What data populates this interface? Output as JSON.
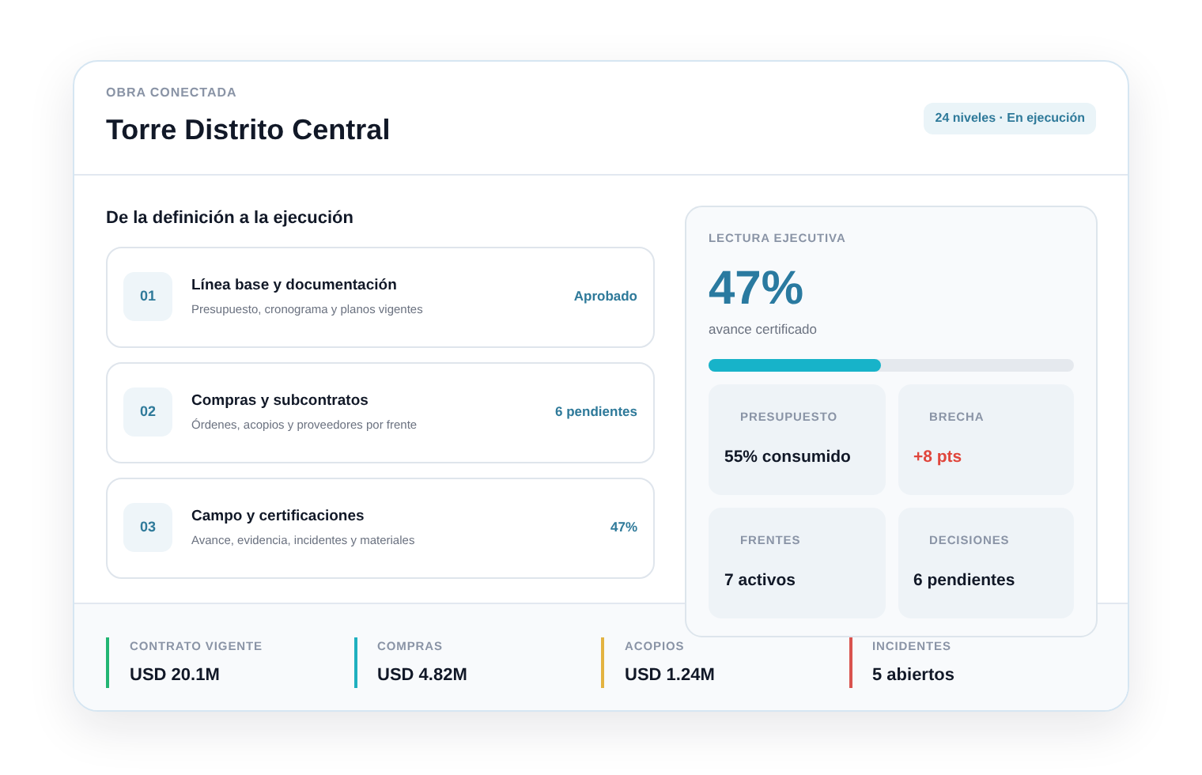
{
  "header": {
    "eyebrow": "OBRA CONECTADA",
    "title": "Torre Distrito Central",
    "badge": "24 niveles · En ejecución"
  },
  "phases": {
    "title": "De la definición a la ejecución",
    "items": [
      {
        "number": "01",
        "title": "Línea base y documentación",
        "subtitle": "Presupuesto, cronograma y planos vigentes",
        "status": "Aprobado"
      },
      {
        "number": "02",
        "title": "Compras y subcontratos",
        "subtitle": "Órdenes, acopios y proveedores por frente",
        "status": "6 pendientes"
      },
      {
        "number": "03",
        "title": "Campo y certificaciones",
        "subtitle": "Avance, evidencia, incidentes y materiales",
        "status": "47%"
      }
    ]
  },
  "executive": {
    "eyebrow": "LECTURA EJECUTIVA",
    "value": "47%",
    "caption": "avance certificado",
    "level": 0.47,
    "tiles": [
      {
        "label": "PRESUPUESTO",
        "value": "55% consumido",
        "color": "#111827"
      },
      {
        "label": "BRECHA",
        "value": "+8 pts",
        "color": "#e0463c"
      },
      {
        "label": "FRENTES",
        "value": "7 activos",
        "color": "#111827"
      },
      {
        "label": "DECISIONES",
        "value": "6 pendientes",
        "color": "#111827"
      }
    ]
  },
  "metrics": [
    {
      "label": "CONTRATO VIGENTE",
      "value": "USD 20.1M",
      "color": "#22b573"
    },
    {
      "label": "COMPRAS",
      "value": "USD 4.82M",
      "color": "#1fb0bf"
    },
    {
      "label": "ACOPIOS",
      "value": "USD 1.24M",
      "color": "#e3b341"
    },
    {
      "label": "INCIDENTES",
      "value": "5 abiertos",
      "color": "#d9534f"
    }
  ]
}
